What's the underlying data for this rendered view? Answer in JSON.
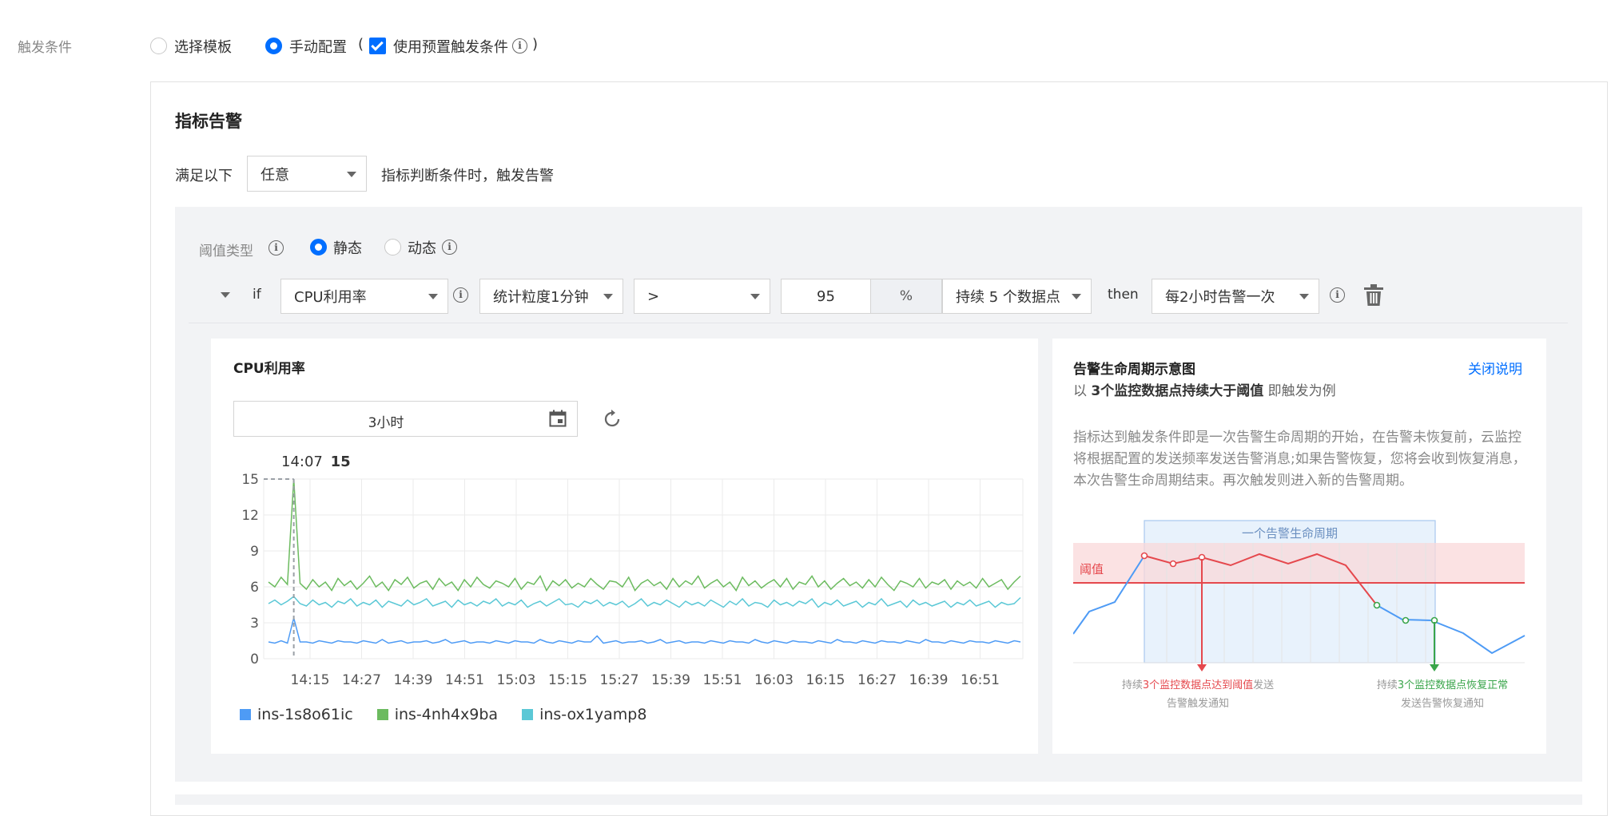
{
  "trigger": {
    "label": "触发条件",
    "option_template": "选择模板",
    "option_manual": "手动配置",
    "paren_open": "(",
    "paren_close": ")",
    "use_preset_label": "使用预置触发条件"
  },
  "metric_alarm": {
    "title": "指标告警",
    "satisfy_prefix": "满足以下",
    "satisfy_select": "任意",
    "satisfy_suffix": "指标判断条件时，触发告警"
  },
  "threshold": {
    "label": "阈值类型",
    "static": "静态",
    "dynamic": "动态"
  },
  "rule": {
    "if": "if",
    "metric": "CPU利用率",
    "granularity": "统计粒度1分钟",
    "operator": ">",
    "value": "95",
    "unit": "%",
    "duration": "持续 5 个数据点",
    "then": "then",
    "frequency": "每2小时告警一次"
  },
  "chart_panel": {
    "title": "CPU利用率",
    "time_range": "3小时",
    "tooltip_time": "14:07",
    "tooltip_value": "15"
  },
  "chart_data": {
    "type": "line",
    "ylim": [
      0,
      15
    ],
    "yticks": [
      "15",
      "12",
      "9",
      "6",
      "3",
      "0"
    ],
    "xticks": [
      "14:15",
      "14:27",
      "14:39",
      "14:51",
      "15:03",
      "15:15",
      "15:27",
      "15:39",
      "15:51",
      "16:03",
      "16:15",
      "16:27",
      "16:39",
      "16:51"
    ],
    "grid": true,
    "legend_position": "bottom-left",
    "series": [
      {
        "name": "ins-1s8o61ic",
        "color": "#4e9bf5",
        "values": [
          1.4,
          1.3,
          1.5,
          1.3,
          3.4,
          1.4,
          1.4,
          1.3,
          1.5,
          1.4,
          1.3,
          1.5,
          1.4,
          1.4,
          1.3,
          1.5,
          1.4,
          1.3,
          1.6,
          1.3,
          1.4,
          1.5,
          1.3,
          1.4,
          1.4,
          1.5,
          1.3,
          1.4,
          1.6,
          1.3,
          1.4,
          1.5,
          1.3,
          1.4,
          1.4,
          1.3,
          1.5,
          1.4,
          1.3,
          1.5,
          1.4,
          1.4,
          1.3,
          1.6,
          1.4,
          1.3,
          1.5,
          1.4,
          1.3,
          1.5,
          1.4,
          1.4,
          1.9,
          1.3,
          1.4,
          1.5,
          1.3,
          1.4,
          1.4,
          1.5,
          1.3,
          1.4,
          1.6,
          1.3,
          1.4,
          1.5,
          1.3,
          1.4,
          1.4,
          1.3,
          1.5,
          1.4,
          1.3,
          1.5,
          1.4,
          1.4,
          1.3,
          1.6,
          1.4,
          1.3,
          1.5,
          1.4,
          1.3,
          1.5,
          1.4,
          1.4,
          1.3,
          1.5,
          1.4,
          1.3,
          1.6,
          1.4,
          1.4,
          1.3,
          1.5,
          1.4,
          1.3,
          1.5,
          1.4,
          1.4,
          1.3,
          1.5,
          1.4,
          1.3,
          1.6,
          1.4,
          1.4,
          1.3,
          1.5,
          1.4,
          1.3,
          1.5,
          1.4,
          1.4,
          1.3,
          1.5,
          1.4,
          1.3,
          1.5,
          1.4
        ]
      },
      {
        "name": "ins-4nh4x9ba",
        "color": "#6cbb5f",
        "values": [
          6.4,
          6.0,
          6.8,
          6.2,
          15,
          6.3,
          5.8,
          6.6,
          6.0,
          6.4,
          5.7,
          6.7,
          6.1,
          6.5,
          5.8,
          6.3,
          6.9,
          6.0,
          6.4,
          5.7,
          6.6,
          6.2,
          6.8,
          5.9,
          6.3,
          6.5,
          5.8,
          6.7,
          6.1,
          6.4,
          5.7,
          6.6,
          6.0,
          6.8,
          6.2,
          5.9,
          6.5,
          6.3,
          6.0,
          6.7,
          5.8,
          6.4,
          6.2,
          6.9,
          5.7,
          6.5,
          6.1,
          6.6,
          5.9,
          6.3,
          6.0,
          6.7,
          6.2,
          5.8,
          6.5,
          6.4,
          6.0,
          6.8,
          5.7,
          6.3,
          6.6,
          6.1,
          6.4,
          5.8,
          6.7,
          6.0,
          6.5,
          6.2,
          6.9,
          5.9,
          6.3,
          6.6,
          6.0,
          6.4,
          5.7,
          6.8,
          6.1,
          6.5,
          5.9,
          6.3,
          6.6,
          6.0,
          6.7,
          5.8,
          6.4,
          6.2,
          6.9,
          6.0,
          6.5,
          5.8,
          6.3,
          6.7,
          6.1,
          6.4,
          5.9,
          6.6,
          6.0,
          6.8,
          6.2,
          5.7,
          6.5,
          6.3,
          6.0,
          6.7,
          5.9,
          6.4,
          6.2,
          6.6,
          5.8,
          6.5,
          6.1,
          6.4,
          5.9,
          6.7,
          6.0,
          6.3,
          6.6,
          5.8,
          6.4,
          6.9
        ]
      },
      {
        "name": "ins-ox1yamp8",
        "color": "#5bc8d6",
        "values": [
          4.6,
          4.9,
          4.5,
          4.8,
          5.2,
          4.6,
          4.4,
          4.9,
          4.5,
          4.7,
          4.3,
          4.8,
          4.6,
          5.0,
          4.4,
          4.7,
          4.5,
          4.9,
          4.3,
          4.8,
          4.6,
          4.4,
          4.9,
          4.5,
          4.7,
          5.0,
          4.4,
          4.6,
          4.8,
          4.3,
          4.9,
          4.5,
          4.7,
          4.4,
          4.8,
          4.6,
          5.0,
          4.4,
          4.7,
          4.5,
          4.9,
          4.3,
          4.6,
          4.8,
          4.4,
          4.7,
          5.0,
          4.5,
          4.6,
          4.3,
          4.8,
          4.6,
          4.9,
          4.4,
          4.7,
          4.5,
          4.8,
          4.3,
          4.6,
          5.0,
          4.4,
          4.7,
          4.5,
          4.9,
          4.6,
          4.3,
          4.8,
          4.5,
          4.7,
          4.4,
          4.9,
          4.6,
          4.3,
          4.8,
          4.5,
          5.0,
          4.4,
          4.7,
          4.6,
          4.3,
          4.9,
          4.5,
          4.7,
          4.4,
          4.8,
          4.6,
          5.0,
          4.3,
          4.7,
          4.5,
          4.9,
          4.4,
          4.6,
          4.8,
          4.3,
          4.7,
          4.5,
          5.0,
          4.4,
          4.6,
          4.8,
          4.3,
          4.9,
          4.5,
          4.7,
          4.4,
          4.6,
          4.8,
          4.3,
          4.7,
          4.5,
          4.9,
          4.4,
          4.6,
          4.8,
          4.3,
          4.7,
          4.5,
          4.6,
          5.1
        ]
      }
    ]
  },
  "lifecycle": {
    "title": "告警生命周期示意图",
    "close_link": "关闭说明",
    "subtitle_prefix": "以",
    "subtitle_bold": "3个监控数据点持续大于阈值",
    "subtitle_suffix": "即触发为例",
    "description": "指标达到触发条件即是一次告警生命周期的开始，在告警未恢复前，云监控将根据配置的发送频率发送告警消息;如果告警恢复，您将会收到恢复消息，本次告警生命周期结束。再次触发则进入新的告警周期。",
    "cycle_label": "一个告警生命周期",
    "threshold_label": "阈值",
    "trigger_note_prefix": "持续",
    "trigger_note_highlight": "3个监控数据点达到阈值",
    "trigger_note_suffix": "发送",
    "trigger_note_line2": "告警触发通知",
    "recover_note_prefix": "持续",
    "recover_note_highlight": "3个监控数据点恢复正常",
    "recover_note_line2": "发送告警恢复通知",
    "colors": {
      "alarm": "#e5484d",
      "recover": "#3aa54b",
      "cycle": "#8fb6e8",
      "line": "#4e9bf5"
    }
  }
}
